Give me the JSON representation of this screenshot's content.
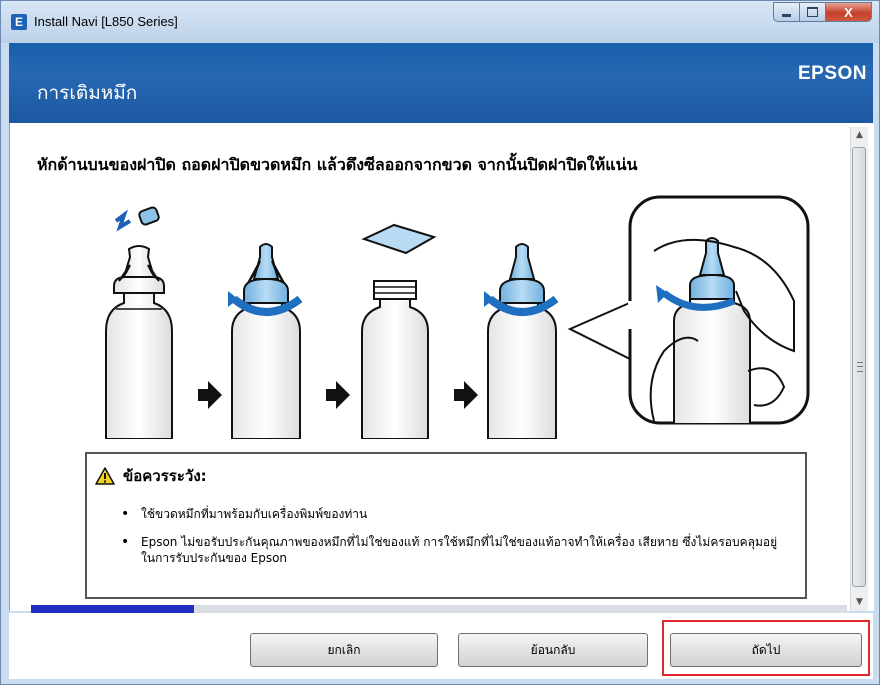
{
  "window": {
    "title": "Install Navi [L850 Series]",
    "app_icon_letter": "E",
    "close_glyph": "X"
  },
  "header": {
    "title": "การเติมหมึก",
    "brand": "EPSON",
    "color": "#1f63ad"
  },
  "instruction": "หักด้านบนของฝาปิด ถอดฝาปิดขวดหมึก แล้วดึงซีลออกจากขวด จากนั้นปิดฝาปิดให้แน่น",
  "illustration": {
    "icons": [
      "ink-bottle-icon",
      "arrow-right-icon",
      "twist-cap-icon",
      "seal-icon",
      "hand-icon"
    ],
    "ink_color": "#8ec3e8"
  },
  "caution": {
    "title": "ข้อควรระวัง:",
    "items": [
      "ใช้ขวดหมึกที่มาพร้อมกับเครื่องพิมพ์ของท่าน",
      "Epson ไม่ขอรับประกันคุณภาพของหมึกที่ไม่ใช่ของแท้ การใช้หมึกที่ไม่ใช่ของแท้อาจทำให้เครื่อง เสียหาย ซึ่งไม่ครอบคลุมอยู่ในการรับประกันของ Epson"
    ],
    "bullet": "•"
  },
  "progress": {
    "value": 0.2,
    "color": "#1f2fc4"
  },
  "buttons": {
    "cancel": "ยกเลิก",
    "back": "ย้อนกลับ",
    "next": "ถัดไป"
  },
  "highlight_color": "#e0282a"
}
